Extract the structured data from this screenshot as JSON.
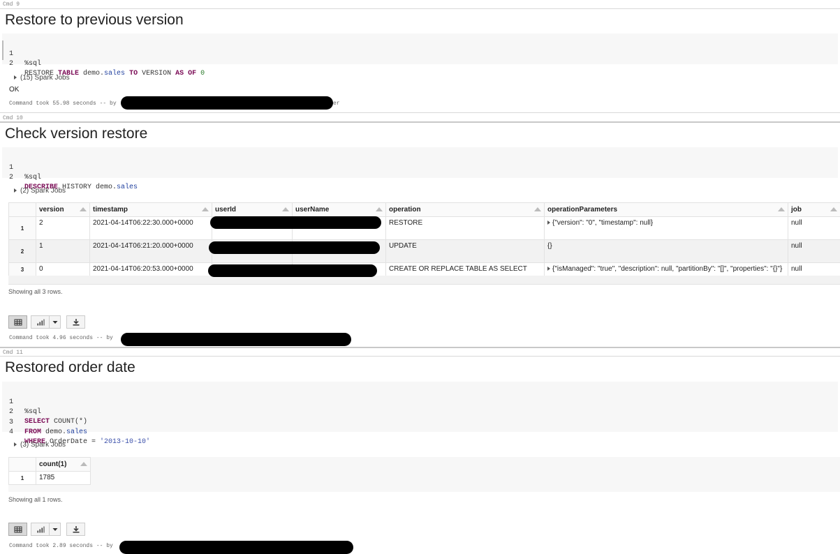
{
  "cells": [
    {
      "cmd": "Cmd 9",
      "title": "Restore to previous version",
      "code": [
        {
          "n": "1",
          "parts": [
            {
              "t": "%sql",
              "c": ""
            }
          ]
        },
        {
          "n": "2",
          "parts": [
            {
              "t": "RESTORE ",
              "c": ""
            },
            {
              "t": "TABLE",
              "c": "kw"
            },
            {
              "t": " demo.",
              "c": ""
            },
            {
              "t": "sales",
              "c": "id"
            },
            {
              "t": " ",
              "c": ""
            },
            {
              "t": "TO",
              "c": "kw"
            },
            {
              "t": " VERSION ",
              "c": ""
            },
            {
              "t": "AS",
              "c": "kw"
            },
            {
              "t": " ",
              "c": ""
            },
            {
              "t": "OF",
              "c": "kw"
            },
            {
              "t": " ",
              "c": ""
            },
            {
              "t": "0",
              "c": "num"
            }
          ]
        }
      ],
      "jobs": "(15) Spark Jobs",
      "result": "OK",
      "took": "Command took 55.98 seconds -- by",
      "took_tail": "er"
    },
    {
      "cmd": "Cmd 10",
      "title": "Check version restore",
      "code": [
        {
          "n": "1",
          "parts": [
            {
              "t": "%sql",
              "c": ""
            }
          ]
        },
        {
          "n": "2",
          "parts": [
            {
              "t": "DESCRIBE",
              "c": "kw"
            },
            {
              "t": " HISTORY demo.",
              "c": ""
            },
            {
              "t": "sales",
              "c": "id"
            }
          ]
        }
      ],
      "jobs": "(2) Spark Jobs",
      "table": {
        "columns": [
          "version",
          "timestamp",
          "userId",
          "userName",
          "operation",
          "operationParameters",
          "job"
        ],
        "rows": [
          {
            "n": "1",
            "version": "2",
            "timestamp": "2021-04-14T06:22:30.000+0000",
            "operation": "RESTORE",
            "params": "{\"version\": \"0\", \"timestamp\": null}",
            "params_expand": true,
            "job": "null"
          },
          {
            "n": "2",
            "version": "1",
            "timestamp": "2021-04-14T06:21:20.000+0000",
            "operation": "UPDATE",
            "params": "{}",
            "params_expand": false,
            "job": "null"
          },
          {
            "n": "3",
            "version": "0",
            "timestamp": "2021-04-14T06:20:53.000+0000",
            "operation": "CREATE OR REPLACE TABLE AS SELECT",
            "params": "{\"isManaged\": \"true\", \"description\": null, \"partitionBy\": \"[]\", \"properties\": \"{}\"}",
            "params_expand": true,
            "job": "null"
          }
        ]
      },
      "showing": "Showing all 3 rows.",
      "took": "Command took 4.96 seconds -- by"
    },
    {
      "cmd": "Cmd 11",
      "title": "Restored order date",
      "code": [
        {
          "n": "1",
          "parts": [
            {
              "t": "%sql",
              "c": ""
            }
          ]
        },
        {
          "n": "2",
          "parts": [
            {
              "t": "SELECT",
              "c": "kw"
            },
            {
              "t": " COUNT(*)",
              "c": ""
            }
          ]
        },
        {
          "n": "3",
          "parts": [
            {
              "t": "FROM",
              "c": "kw"
            },
            {
              "t": " demo.",
              "c": ""
            },
            {
              "t": "sales",
              "c": "id"
            }
          ]
        },
        {
          "n": "4",
          "parts": [
            {
              "t": "WHERE",
              "c": "kw"
            },
            {
              "t": " OrderDate = ",
              "c": ""
            },
            {
              "t": "'2013-10-10'",
              "c": "str"
            }
          ]
        }
      ],
      "jobs": "(3) Spark Jobs",
      "table": {
        "columns": [
          "count(1)"
        ],
        "rows": [
          {
            "n": "1",
            "value": "1785"
          }
        ]
      },
      "showing": "Showing all 1 rows.",
      "took": "Command took 2.89 seconds -- by"
    }
  ],
  "icons": {
    "table_view": "table-icon",
    "chart_view": "bar-chart-icon",
    "chart_dropdown": "caret-down-icon",
    "download": "download-icon",
    "jobs_toggle": "caret-right-icon",
    "sort": "sort-up-icon"
  }
}
